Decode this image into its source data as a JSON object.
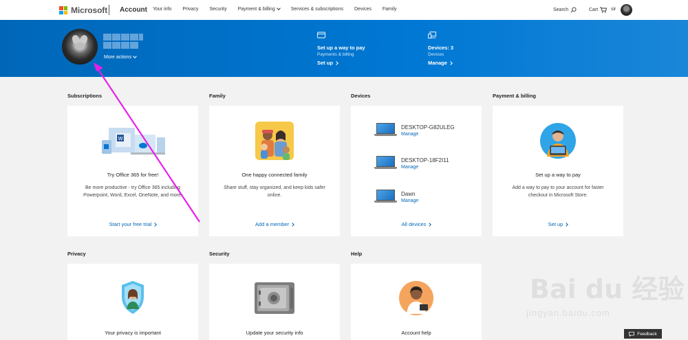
{
  "nav": {
    "brand": "Microsoft",
    "account": "Account",
    "links": [
      "Your info",
      "Privacy",
      "Security",
      "Payment & billing",
      "Services & subscriptions",
      "Devices",
      "Family"
    ],
    "search": "Search",
    "cart": "Cart",
    "user": "sir"
  },
  "brand_colors": [
    "#f25022",
    "#7fba00",
    "#00a4ef",
    "#ffb900"
  ],
  "banner": {
    "more_actions": "More actions",
    "pay": {
      "title": "Set up a way to pay",
      "sub": "Payments & billing",
      "link": "Set up"
    },
    "devices": {
      "title": "Devices: 3",
      "sub": "Devices",
      "link": "Manage"
    }
  },
  "sections": {
    "subscriptions": {
      "heading": "Subscriptions",
      "title": "Try Office 365 for free!",
      "desc": "Be more productive - try Office 365 including Powerpoint, Word, Excel, OneNote, and more.",
      "link": "Start your free trial"
    },
    "family": {
      "heading": "Family",
      "title": "One happy connected family",
      "desc": "Share stuff, stay organized, and keep kids safer online.",
      "link": "Add a member"
    },
    "devices": {
      "heading": "Devices",
      "items": [
        {
          "name": "DESKTOP-G82ULEG",
          "action": "Manage"
        },
        {
          "name": "DESKTOP-18F2I11",
          "action": "Manage"
        },
        {
          "name": "Dawn",
          "action": "Manage"
        }
      ],
      "link": "All devices"
    },
    "payment": {
      "heading": "Payment & billing",
      "title": "Set up a way to pay",
      "desc": "Add a way to pay to your account for faster checkout in Microsoft Store.",
      "link": "Set up"
    },
    "privacy": {
      "heading": "Privacy",
      "title": "Your privacy is important"
    },
    "security": {
      "heading": "Security",
      "title": "Update your security info"
    },
    "help": {
      "heading": "Help",
      "title": "Account help"
    }
  },
  "feedback": "Feedback",
  "watermark": {
    "main": "Bai du 经验",
    "sub": "jingyan.baidu.com"
  }
}
